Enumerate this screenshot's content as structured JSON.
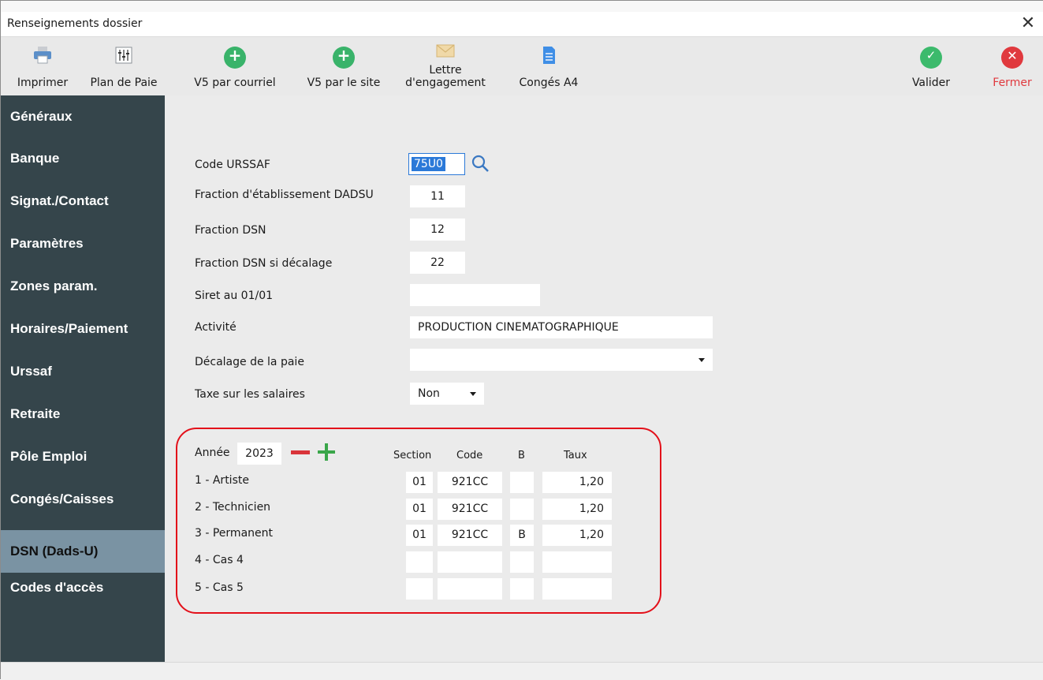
{
  "window": {
    "title": "Renseignements dossier"
  },
  "toolbar": {
    "print": "Imprimer",
    "plan": "Plan de Paie",
    "v5_mail": "V5 par courriel",
    "v5_site": "V5 par le site",
    "letter_line1": "Lettre",
    "letter_line2": "d'engagement",
    "conges": "Congés A4",
    "validate": "Valider",
    "close": "Fermer"
  },
  "colors": {
    "close_red": "#e0393e",
    "validate_green": "#3cba6c",
    "add_green": "#39b36a",
    "sidebar_bg": "#35454b",
    "sidebar_active": "#7a93a3",
    "highlight_red": "#e3101a"
  },
  "sidebar": {
    "items": [
      {
        "label": "Généraux"
      },
      {
        "label": "Banque"
      },
      {
        "label": "Signat./Contact"
      },
      {
        "label": "Paramètres"
      },
      {
        "label": "Zones param."
      },
      {
        "label": "Horaires/Paiement"
      },
      {
        "label": "Urssaf"
      },
      {
        "label": "Retraite"
      },
      {
        "label": "Pôle Emploi"
      },
      {
        "label": "Congés/Caisses"
      },
      {
        "label": "DSN (Dads-U)"
      },
      {
        "label": "Codes d'accès"
      }
    ],
    "active_index": 10
  },
  "form": {
    "code_urssaf": {
      "label": "Code URSSAF",
      "value": "75U0"
    },
    "fraction_dadsu": {
      "label": "Fraction d'établissement DADSU",
      "value": "11"
    },
    "fraction_dsn": {
      "label": "Fraction DSN",
      "value": "12"
    },
    "fraction_dsn_decalage": {
      "label": "Fraction DSN si décalage",
      "value": "22"
    },
    "siret": {
      "label": "Siret au 01/01",
      "value": ""
    },
    "activite": {
      "label": "Activité",
      "value": "PRODUCTION CINEMATOGRAPHIQUE"
    },
    "decalage": {
      "label": "Décalage de la paie",
      "value": ""
    },
    "taxe": {
      "label": "Taxe sur les salaires",
      "value": "Non"
    }
  },
  "cases": {
    "annee_label": "Année",
    "annee_value": "2023",
    "headers": {
      "section": "Section",
      "code": "Code",
      "b": "B",
      "taux": "Taux"
    },
    "rows": [
      {
        "label": "1 - Artiste",
        "section": "01",
        "code": "921CC",
        "b": "",
        "taux": "1,20"
      },
      {
        "label": "2 - Technicien",
        "section": "01",
        "code": "921CC",
        "b": "",
        "taux": "1,20"
      },
      {
        "label": "3 - Permanent",
        "section": "01",
        "code": "921CC",
        "b": "B",
        "taux": "1,20"
      },
      {
        "label": "4 - Cas 4",
        "section": "",
        "code": "",
        "b": "",
        "taux": ""
      },
      {
        "label": "5 - Cas 5",
        "section": "",
        "code": "",
        "b": "",
        "taux": ""
      }
    ]
  }
}
